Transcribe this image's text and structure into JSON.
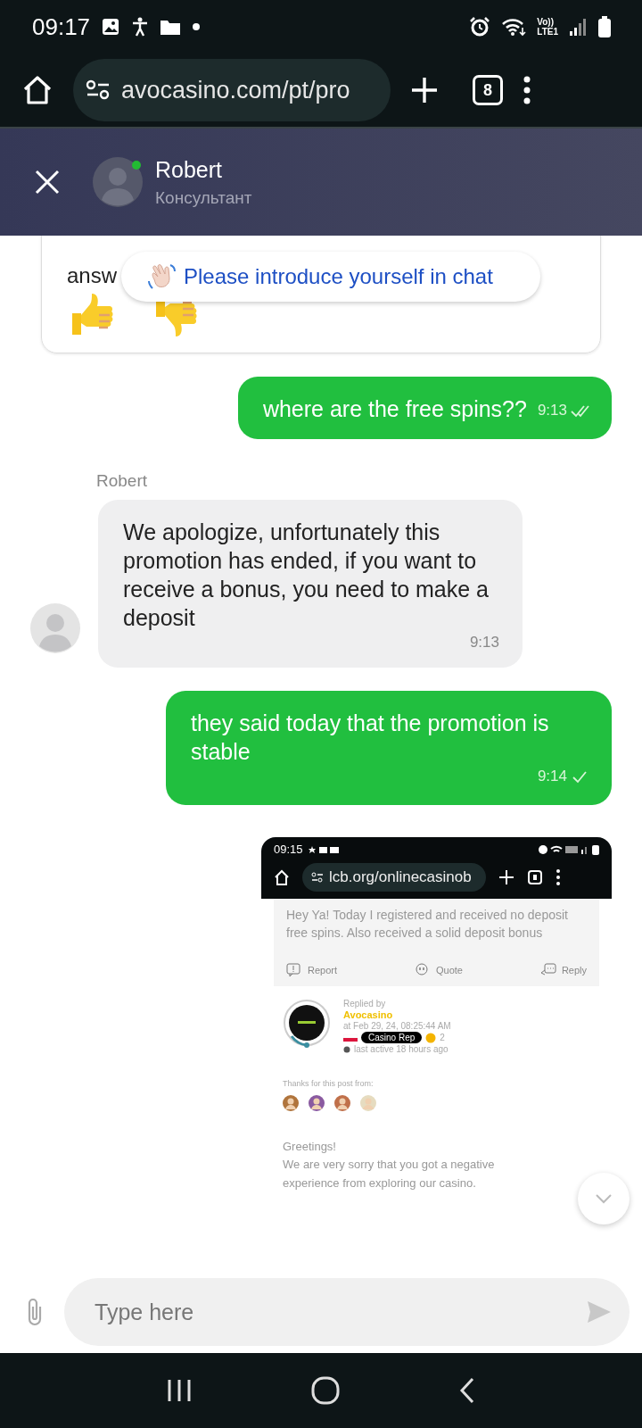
{
  "status_bar": {
    "time": "09:17",
    "volte": "Vo))",
    "network": "LTE1"
  },
  "browser": {
    "url": "avocasino.com/pt/pro",
    "tab_count": "8"
  },
  "chat_header": {
    "name": "Robert",
    "role": "Консультант",
    "online": true
  },
  "rating_card": {
    "question": "answ",
    "toast": "Please introduce yourself in chat"
  },
  "messages": [
    {
      "kind": "outgoing",
      "text": "where are the free spins??",
      "time": "9:13",
      "read": true
    },
    {
      "kind": "incoming",
      "sender": "Robert",
      "text": "We apologize, unfortunately this promotion has ended, if you want to receive a bonus, you need to make a deposit",
      "time": "9:13"
    },
    {
      "kind": "outgoing",
      "text": "they said today that the promotion is stable",
      "time": "9:14",
      "read": false
    },
    {
      "kind": "screenshot",
      "shot": {
        "time": "09:15",
        "url": "lcb.org/onlinecasinob",
        "post": "Hey Ya! Today I registered and received no deposit free spins. Also received a solid deposit bonus",
        "actions": [
          "Report",
          "Quote",
          "Reply"
        ],
        "replied_by": "Replied by",
        "author": "Avocasino",
        "date": "at Feb 29, 24, 08:25:44 AM",
        "badge": "Casino Rep",
        "count": "2",
        "last_active": "last active 18 hours ago",
        "thanks": "Thanks for this post from:",
        "greeting": "Greetings!",
        "body": "We are very sorry that you got a negative experience from exploring our casino."
      }
    }
  ],
  "composer": {
    "placeholder": "Type here"
  }
}
